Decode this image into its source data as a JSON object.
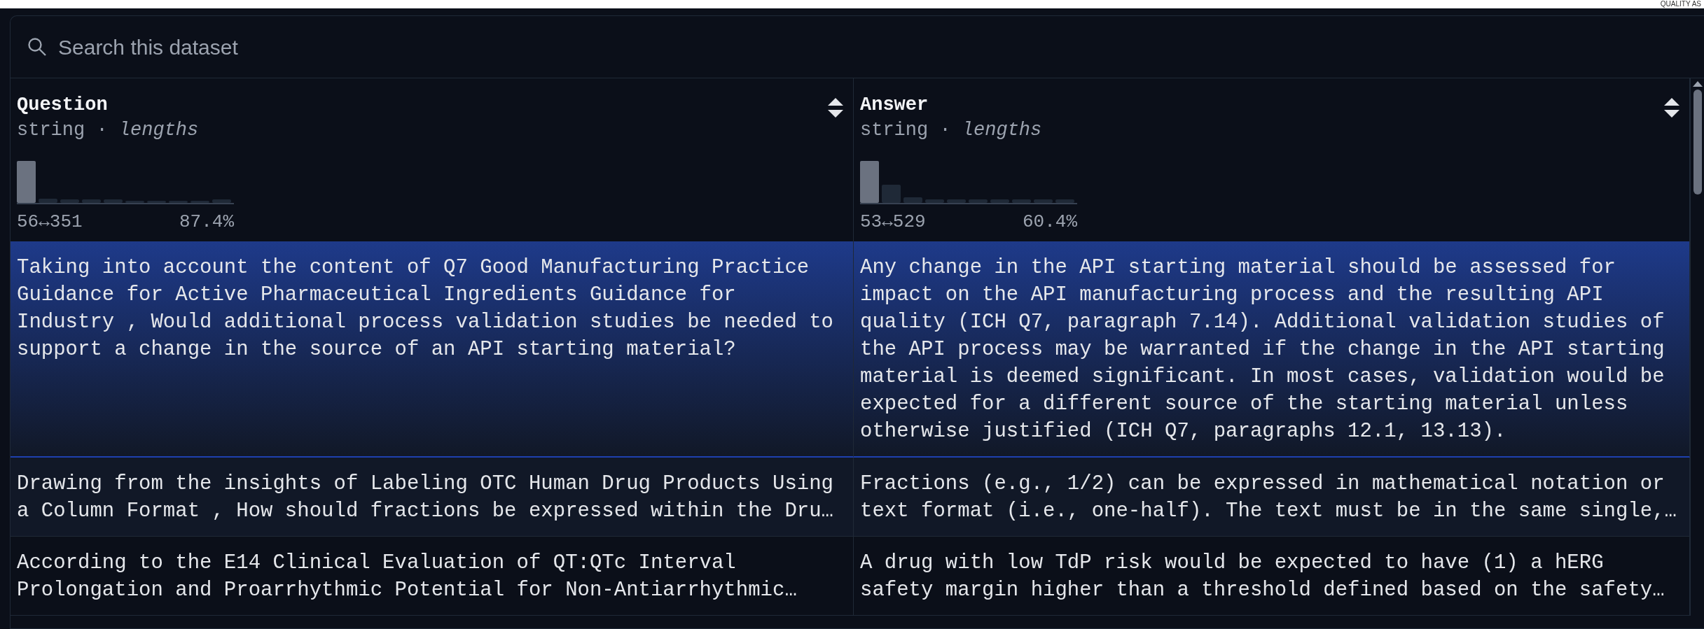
{
  "corner_label": "QUALITY AS",
  "search": {
    "placeholder": "Search this dataset"
  },
  "table": {
    "columns": [
      {
        "name": "Question",
        "subtitle": "string · *lengths*",
        "range": "56↔351",
        "share": "87.4%"
      },
      {
        "name": "Answer",
        "subtitle": "string · *lengths*",
        "range": "53↔529",
        "share": "60.4%"
      }
    ],
    "rows": [
      {
        "selected": true,
        "cells": [
          "Taking into account the content of Q7 Good Manufacturing Practice\nGuidance for Active Pharmaceutical Ingredients Guidance for\nIndustry , Would additional process validation studies be needed to\nsupport a change in the source of an API starting material?",
          "Any change in the API starting material should be assessed for\nimpact on the API manufacturing process and the resulting API\nquality (ICH Q7, paragraph 7.14). Additional validation studies of\nthe API process may be warranted if the change in the API starting\nmaterial is deemed significant. In most cases, validation would be\nexpected for a different source of the starting material unless\notherwise justified (ICH Q7, paragraphs 12.1, 13.13)."
        ]
      },
      {
        "selected": false,
        "cells": [
          "Drawing from the insights of Labeling OTC Human Drug Products Using\na Column Format , How should fractions be expressed within the Dru…",
          "Fractions (e.g., 1/2) can be expressed in mathematical notation or\ntext format (i.e., one-half). The text must be in the same single,…"
        ]
      },
      {
        "selected": false,
        "cells": [
          "According to the E14 Clinical Evaluation of QT:QTc Interval\nProlongation and Proarrhythmic Potential for Non-Antiarrhythmic…",
          "A drug with low TdP risk would be expected to have (1) a hERG\nsafety margin higher than a threshold defined based on the safety…"
        ]
      }
    ]
  }
}
